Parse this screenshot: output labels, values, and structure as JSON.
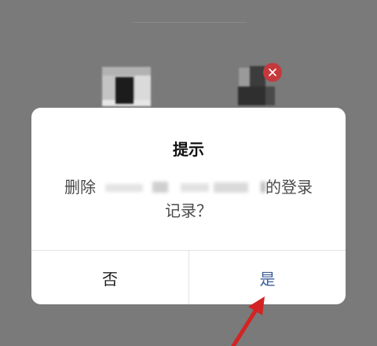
{
  "dialog": {
    "title": "提示",
    "message": {
      "prefix": "删除",
      "suffix": "的登录",
      "line2": "记录？"
    },
    "buttons": {
      "cancel_label": "否",
      "confirm_label": "是"
    }
  },
  "account_list": {
    "remove_badge_icon": "close-icon"
  },
  "colors": {
    "overlay": "#7a7a7a",
    "dialog_background": "#ffffff",
    "confirm_text": "#3d5d9b",
    "cancel_text": "#222222",
    "remove_badge": "#c5393d",
    "annotation_arrow": "#d42323"
  }
}
